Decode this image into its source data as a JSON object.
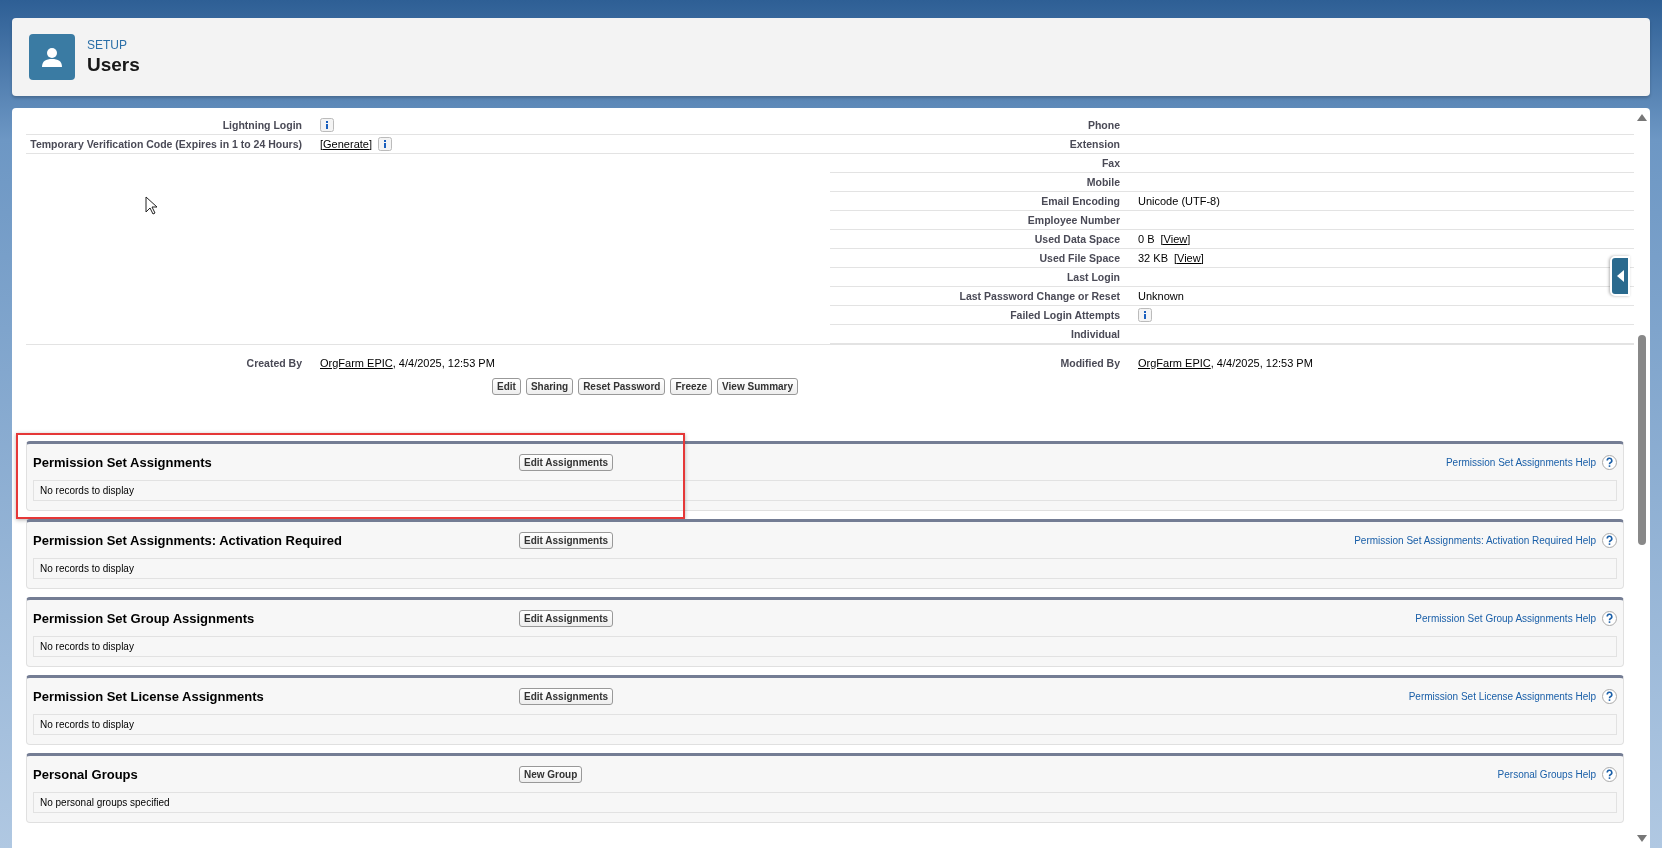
{
  "header": {
    "eyebrow": "SETUP",
    "title": "Users"
  },
  "details": {
    "left": [
      {
        "label": "Lightning Login",
        "value": {
          "info": true
        }
      },
      {
        "label": "Temporary Verification Code (Expires in 1 to 24 Hours)",
        "value": {
          "link": "[Generate]",
          "info": true
        }
      }
    ],
    "right": [
      {
        "label": "Phone"
      },
      {
        "label": "Extension"
      },
      {
        "label": "Fax"
      },
      {
        "label": "Mobile"
      },
      {
        "label": "Email Encoding",
        "value": {
          "text": "Unicode (UTF-8)"
        }
      },
      {
        "label": "Employee Number"
      },
      {
        "label": "Used Data Space",
        "value": {
          "text": "0 B",
          "link": "[View]"
        }
      },
      {
        "label": "Used File Space",
        "value": {
          "text": "32 KB",
          "link": "[View]"
        }
      },
      {
        "label": "Last Login"
      },
      {
        "label": "Last Password Change or Reset",
        "value": {
          "text": "Unknown"
        }
      },
      {
        "label": "Failed Login Attempts",
        "value": {
          "info": true
        }
      },
      {
        "label": "Individual"
      }
    ],
    "bottom": [
      {
        "label": "Created By",
        "value": {
          "link": "OrgFarm EPIC",
          "suffix": ", 4/4/2025, 12:53 PM"
        }
      },
      {
        "label": "Modified By",
        "value": {
          "link": "OrgFarm EPIC",
          "suffix": ", 4/4/2025, 12:53 PM"
        }
      }
    ]
  },
  "buttons": [
    "Edit",
    "Sharing",
    "Reset Password",
    "Freeze",
    "View Summary"
  ],
  "sections": [
    {
      "title": "Permission Set Assignments",
      "button": "Edit Assignments",
      "help": "Permission Set Assignments Help",
      "empty": "No records to display",
      "highlighted": true
    },
    {
      "title": "Permission Set Assignments: Activation Required",
      "button": "Edit Assignments",
      "help": "Permission Set Assignments: Activation Required Help",
      "empty": "No records to display",
      "highlighted": false
    },
    {
      "title": "Permission Set Group Assignments",
      "button": "Edit Assignments",
      "help": "Permission Set Group Assignments Help",
      "empty": "No records to display",
      "highlighted": false
    },
    {
      "title": "Permission Set License Assignments",
      "button": "Edit Assignments",
      "help": "Permission Set License Assignments Help",
      "empty": "No records to display",
      "highlighted": false
    },
    {
      "title": "Personal Groups",
      "button": "New Group",
      "help": "Personal Groups Help",
      "empty": "No personal groups specified",
      "highlighted": false
    }
  ]
}
